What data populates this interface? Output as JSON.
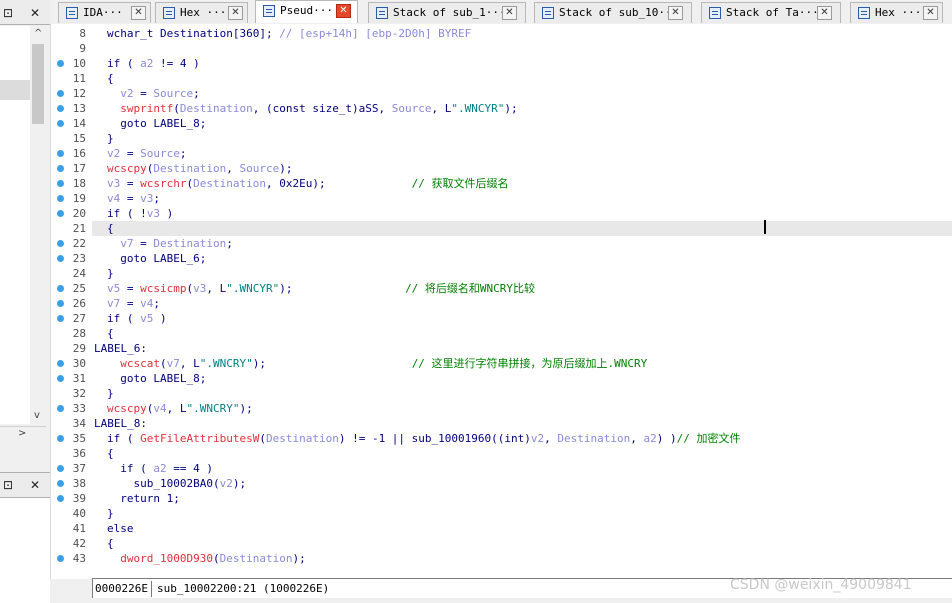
{
  "tabs": [
    {
      "label": "IDA···",
      "icon": "ida-view-icon"
    },
    {
      "label": "Hex ···",
      "icon": "hex-view-icon"
    },
    {
      "label": "Pseud···",
      "icon": "pseudocode-icon",
      "active": true
    },
    {
      "label": "Stack of sub_1···",
      "icon": "stack-view-icon"
    },
    {
      "label": "Stack of sub_10···",
      "icon": "stack-view-icon"
    },
    {
      "label": "Stack of Ta···",
      "icon": "stack-view-icon"
    },
    {
      "label": "Hex ···",
      "icon": "hex-view-icon"
    }
  ],
  "tab_close_glyph": "✕",
  "left_panel": {
    "restore_glyph": "⊡",
    "close_glyph": "✕",
    "scroll_up": "^",
    "scroll_down": "v",
    "scroll_right": ">"
  },
  "code_lines": [
    {
      "num": "8",
      "dot": false,
      "html": "wchar_t Destination[360]; <span class='v'>// [esp+14h] [ebp-2D0h] BYREF</span>"
    },
    {
      "num": "9",
      "dot": false,
      "html": ""
    },
    {
      "num": "10",
      "dot": true,
      "html": "if ( <span class='v'>a2</span> != 4 )"
    },
    {
      "num": "11",
      "dot": false,
      "html": "{"
    },
    {
      "num": "12",
      "dot": true,
      "html": "  <span class='v'>v2</span> = <span class='v'>Source</span>;"
    },
    {
      "num": "13",
      "dot": true,
      "html": "  <span class='fn'>swprintf</span>(<span class='v'>Destination</span>, (const size_t)aSS, <span class='v'>Source</span>, L<span class='str'>\".WNCYR\"</span>);"
    },
    {
      "num": "14",
      "dot": true,
      "html": "  goto LABEL_8;"
    },
    {
      "num": "15",
      "dot": false,
      "html": "}"
    },
    {
      "num": "16",
      "dot": true,
      "html": "<span class='v'>v2</span> = <span class='v'>Source</span>;"
    },
    {
      "num": "17",
      "dot": true,
      "html": "<span class='fn'>wcscpy</span>(<span class='v'>Destination</span>, <span class='v'>Source</span>);"
    },
    {
      "num": "18",
      "dot": true,
      "html": "<span class='v'>v3</span> = <span class='fn'>wcsrchr</span>(<span class='v'>Destination</span>, 0x2Eu);             <span class='cm'>// 获取文件后缀名</span>"
    },
    {
      "num": "19",
      "dot": true,
      "html": "<span class='v'>v4</span> = <span class='v'>v3</span>;"
    },
    {
      "num": "20",
      "dot": true,
      "html": "if ( !<span class='v'>v3</span> )"
    },
    {
      "num": "21",
      "dot": false,
      "html": "{",
      "highlight": true
    },
    {
      "num": "22",
      "dot": true,
      "html": "  <span class='v'>v7</span> = <span class='v'>Destination</span>;"
    },
    {
      "num": "23",
      "dot": true,
      "html": "  goto LABEL_6;"
    },
    {
      "num": "24",
      "dot": false,
      "html": "}"
    },
    {
      "num": "25",
      "dot": true,
      "html": "<span class='v'>v5</span> = <span class='fn'>wcsicmp</span>(<span class='v'>v3</span>, L<span class='str'>\".WNCYR\"</span>);                 <span class='cm'>// 将后缀名和WNCRY比较</span>"
    },
    {
      "num": "26",
      "dot": true,
      "html": "<span class='v'>v7</span> = <span class='v'>v4</span>;"
    },
    {
      "num": "27",
      "dot": true,
      "html": "if ( <span class='v'>v5</span> )"
    },
    {
      "num": "28",
      "dot": false,
      "html": "{"
    },
    {
      "num": "29",
      "dot": false,
      "html": "LABEL_6:",
      "label": true
    },
    {
      "num": "30",
      "dot": true,
      "html": "  <span class='fn'>wcscat</span>(<span class='v'>v7</span>, L<span class='str'>\".WNCRY\"</span>);                      <span class='cm'>// 这里进行字符串拼接，为原后缀加上.WNCRY</span>"
    },
    {
      "num": "31",
      "dot": true,
      "html": "  goto LABEL_8;"
    },
    {
      "num": "32",
      "dot": false,
      "html": "}"
    },
    {
      "num": "33",
      "dot": true,
      "html": "<span class='fn'>wcscpy</span>(<span class='v'>v4</span>, L<span class='str'>\".WNCRY\"</span>);"
    },
    {
      "num": "34",
      "dot": false,
      "html": "LABEL_8:",
      "label": true
    },
    {
      "num": "35",
      "dot": true,
      "html": "if ( <span class='fn'>GetFileAttributesW</span>(<span class='v'>Destination</span>) != -1 || sub_10001960((int)<span class='v'>v2</span>, <span class='v'>Destination</span>, <span class='v'>a2</span>) )<span class='cm'>// 加密文件</span>"
    },
    {
      "num": "36",
      "dot": false,
      "html": "{"
    },
    {
      "num": "37",
      "dot": true,
      "html": "  if ( <span class='v'>a2</span> == 4 )"
    },
    {
      "num": "38",
      "dot": true,
      "html": "    sub_10002BA0(<span class='v'>v2</span>);"
    },
    {
      "num": "39",
      "dot": true,
      "html": "  return 1;"
    },
    {
      "num": "40",
      "dot": false,
      "html": "}"
    },
    {
      "num": "41",
      "dot": false,
      "html": "else"
    },
    {
      "num": "42",
      "dot": false,
      "html": "{"
    },
    {
      "num": "43",
      "dot": true,
      "html": "  <span class='fn'>dword_1000D930</span>(<span class='v'>Destination</span>);"
    }
  ],
  "status": {
    "address": "0000226E",
    "location": "sub_10002200:21 (1000226E)"
  },
  "watermark": "CSDN @weixin_49009841",
  "colors": {
    "breakpoint_dot": "#3aa0e6",
    "variable": "#8a8ad8",
    "function": "#e0303a",
    "keyword": "#000080",
    "string": "#008080",
    "comment": "#008000",
    "active_tab_close": "#e8462a"
  }
}
